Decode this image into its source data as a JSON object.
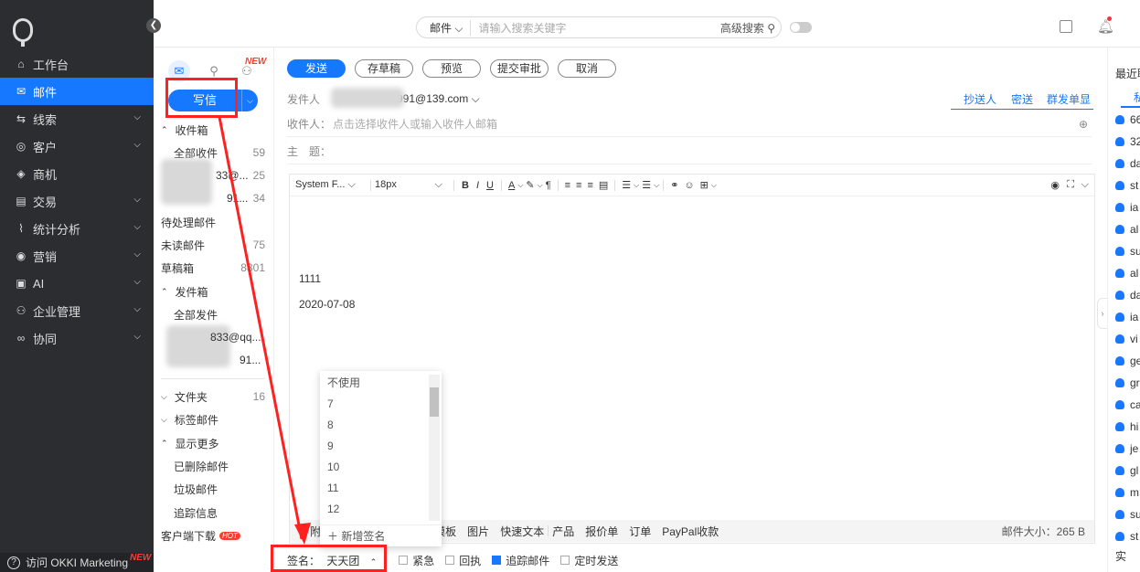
{
  "nav": {
    "items": [
      {
        "label": "工作台",
        "icon": "home-icon",
        "glyph": "⌂",
        "chev": false
      },
      {
        "label": "邮件",
        "icon": "mail-icon",
        "glyph": "✉",
        "chev": false,
        "active": true
      },
      {
        "label": "线索",
        "icon": "leads-icon",
        "glyph": "⇆",
        "chev": true
      },
      {
        "label": "客户",
        "icon": "customer-icon",
        "glyph": "◎",
        "chev": true
      },
      {
        "label": "商机",
        "icon": "opportunity-icon",
        "glyph": "◈",
        "chev": false
      },
      {
        "label": "交易",
        "icon": "deal-icon",
        "glyph": "▤",
        "chev": true
      },
      {
        "label": "统计分析",
        "icon": "chart-icon",
        "glyph": "⌇",
        "chev": true
      },
      {
        "label": "营销",
        "icon": "marketing-icon",
        "glyph": "◉",
        "chev": true
      },
      {
        "label": "AI",
        "icon": "ai-icon",
        "glyph": "▣",
        "chev": true
      },
      {
        "label": "企业管理",
        "icon": "org-icon",
        "glyph": "⚇",
        "chev": true
      },
      {
        "label": "协同",
        "icon": "collab-icon",
        "glyph": "∞",
        "chev": true
      }
    ],
    "visit_label": "访问 OKKI Marketing",
    "new_badge": "NEW"
  },
  "topbar": {
    "scope": "邮件",
    "search_placeholder": "请输入搜索关键字",
    "advanced": "高级搜索"
  },
  "folders": {
    "new_badge": "NEW",
    "compose": "写信",
    "inbox": "收件箱",
    "all_inbox": "全部收件",
    "all_inbox_count": "59",
    "acc1": "33@...",
    "acc1_count": "25",
    "acc2": "91...",
    "acc2_count": "34",
    "pending": "待处理邮件",
    "unread": "未读邮件",
    "unread_count": "75",
    "drafts": "草稿箱",
    "drafts_count": "8801",
    "sent": "发件箱",
    "all_sent": "全部发件",
    "sent_acc1": "833@qq...",
    "sent_acc2": "91...",
    "folder": "文件夹",
    "folder_count": "16",
    "tag": "标签邮件",
    "more": "显示更多",
    "deleted": "已删除邮件",
    "spam": "垃圾邮件",
    "track": "追踪信息",
    "client": "客户端下载",
    "hot": "HOT"
  },
  "compose": {
    "send": "发送",
    "save_draft": "存草稿",
    "preview": "预览",
    "submit": "提交审批",
    "cancel": "取消",
    "sender_label": "发件人",
    "sender_value": "991@139.com",
    "cc": "抄送人",
    "bcc": "密送",
    "group": "群发单显",
    "to_label": "收件人：",
    "to_placeholder": "点击选择收件人或输入收件人邮箱",
    "subject_label": "主　题：",
    "font": "System F...",
    "size": "18px",
    "body_line1": "1111",
    "body_line2": "2020-07-08",
    "attach": "附件",
    "template": "模板",
    "image": "图片",
    "quicktext": "快速文本",
    "product": "产品",
    "quote": "报价单",
    "order": "订单",
    "paypal": "PayPal收款",
    "mail_size": "邮件大小：265 B",
    "signature_label": "签名：",
    "signature_value": "天天团",
    "urgent": "紧急",
    "receipt": "回执",
    "track": "追踪邮件",
    "timed": "定时发送"
  },
  "signature_dropdown": {
    "options": [
      "不使用",
      "7",
      "8",
      "9",
      "10",
      "11",
      "12"
    ],
    "add": "新增签名"
  },
  "recent": {
    "title": "最近联",
    "tab": "私",
    "contacts": [
      "66",
      "32",
      "da",
      "st",
      "ia",
      "al",
      "su",
      "al",
      "da",
      "ia",
      "vi",
      "ge",
      "gr",
      "ca",
      "hi",
      "je",
      "gl",
      "m",
      "su",
      "st"
    ],
    "footer": "实"
  },
  "colors": {
    "accent": "#1677ff",
    "nav_bg": "#2b2d31",
    "annotation": "#ff2020"
  }
}
